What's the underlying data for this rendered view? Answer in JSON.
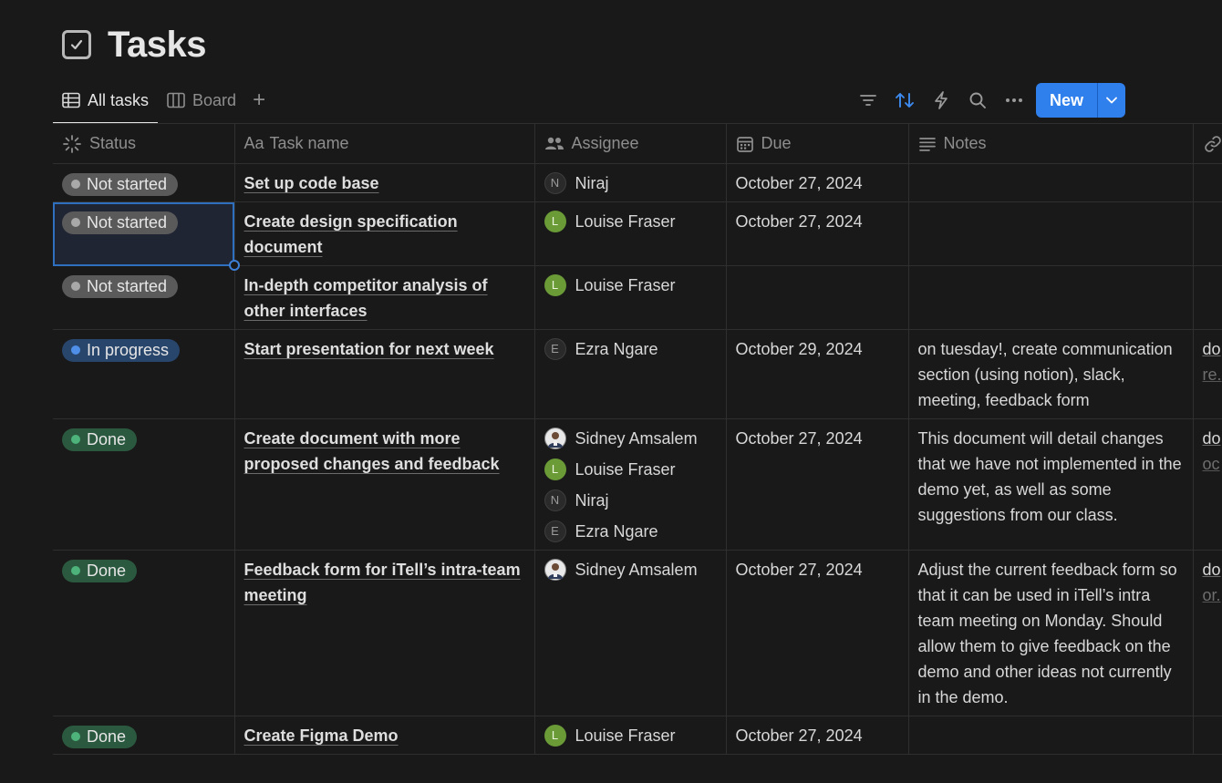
{
  "page": {
    "title": "Tasks"
  },
  "views": [
    {
      "label": "All tasks",
      "active": true
    },
    {
      "label": "Board",
      "active": false
    }
  ],
  "toolbar": {
    "new_label": "New"
  },
  "columns": {
    "status": "Status",
    "task_name": "Task name",
    "task_name_prefix": "Aa",
    "assignee": "Assignee",
    "due": "Due",
    "notes": "Notes"
  },
  "rows": [
    {
      "status": "Not started",
      "task": "Set up code base",
      "assignees": [
        {
          "name": "Niraj",
          "initial": "N"
        }
      ],
      "due": "October 27, 2024",
      "notes": "",
      "link1": "",
      "link2": ""
    },
    {
      "status": "Not started",
      "task": "Create design specification document",
      "assignees": [
        {
          "name": "Louise Fraser",
          "initial": "L"
        }
      ],
      "due": "October 27, 2024",
      "notes": "",
      "link1": "",
      "link2": ""
    },
    {
      "status": "Not started",
      "task": "In-depth competitor analysis of other interfaces",
      "assignees": [
        {
          "name": "Louise Fraser",
          "initial": "L"
        }
      ],
      "due": "",
      "notes": "",
      "link1": "",
      "link2": ""
    },
    {
      "status": "In progress",
      "task": "Start presentation for next week",
      "assignees": [
        {
          "name": "Ezra Ngare",
          "initial": "E"
        }
      ],
      "due": "October 29, 2024",
      "notes": "on tuesday!, create communication section (using notion), slack, meeting, feedback form",
      "link1": "do",
      "link2": "re."
    },
    {
      "status": "Done",
      "task": "Create document with more proposed changes and feedback",
      "assignees": [
        {
          "name": "Sidney Amsalem",
          "initial": ""
        },
        {
          "name": "Louise Fraser",
          "initial": "L"
        },
        {
          "name": "Niraj",
          "initial": "N"
        },
        {
          "name": "Ezra Ngare",
          "initial": "E"
        }
      ],
      "due": "October 27, 2024",
      "notes": "This document will detail changes that we have not implemented in the demo yet, as well as some suggestions from our class.",
      "link1": "do",
      "link2": "oc"
    },
    {
      "status": "Done",
      "task": "Feedback form for iTell’s intra-team meeting",
      "assignees": [
        {
          "name": "Sidney Amsalem",
          "initial": ""
        }
      ],
      "due": "October 27, 2024",
      "notes": "Adjust the current feedback form so that it can be used in iTell’s intra team meeting on Monday. Should allow them to give feedback on the demo and other ideas not currently in the demo.",
      "link1": "do",
      "link2": "or."
    },
    {
      "status": "Done",
      "task": "Create Figma Demo",
      "assignees": [
        {
          "name": "Louise Fraser",
          "initial": "L"
        }
      ],
      "due": "October 27, 2024",
      "notes": "",
      "link1": "",
      "link2": ""
    }
  ]
}
